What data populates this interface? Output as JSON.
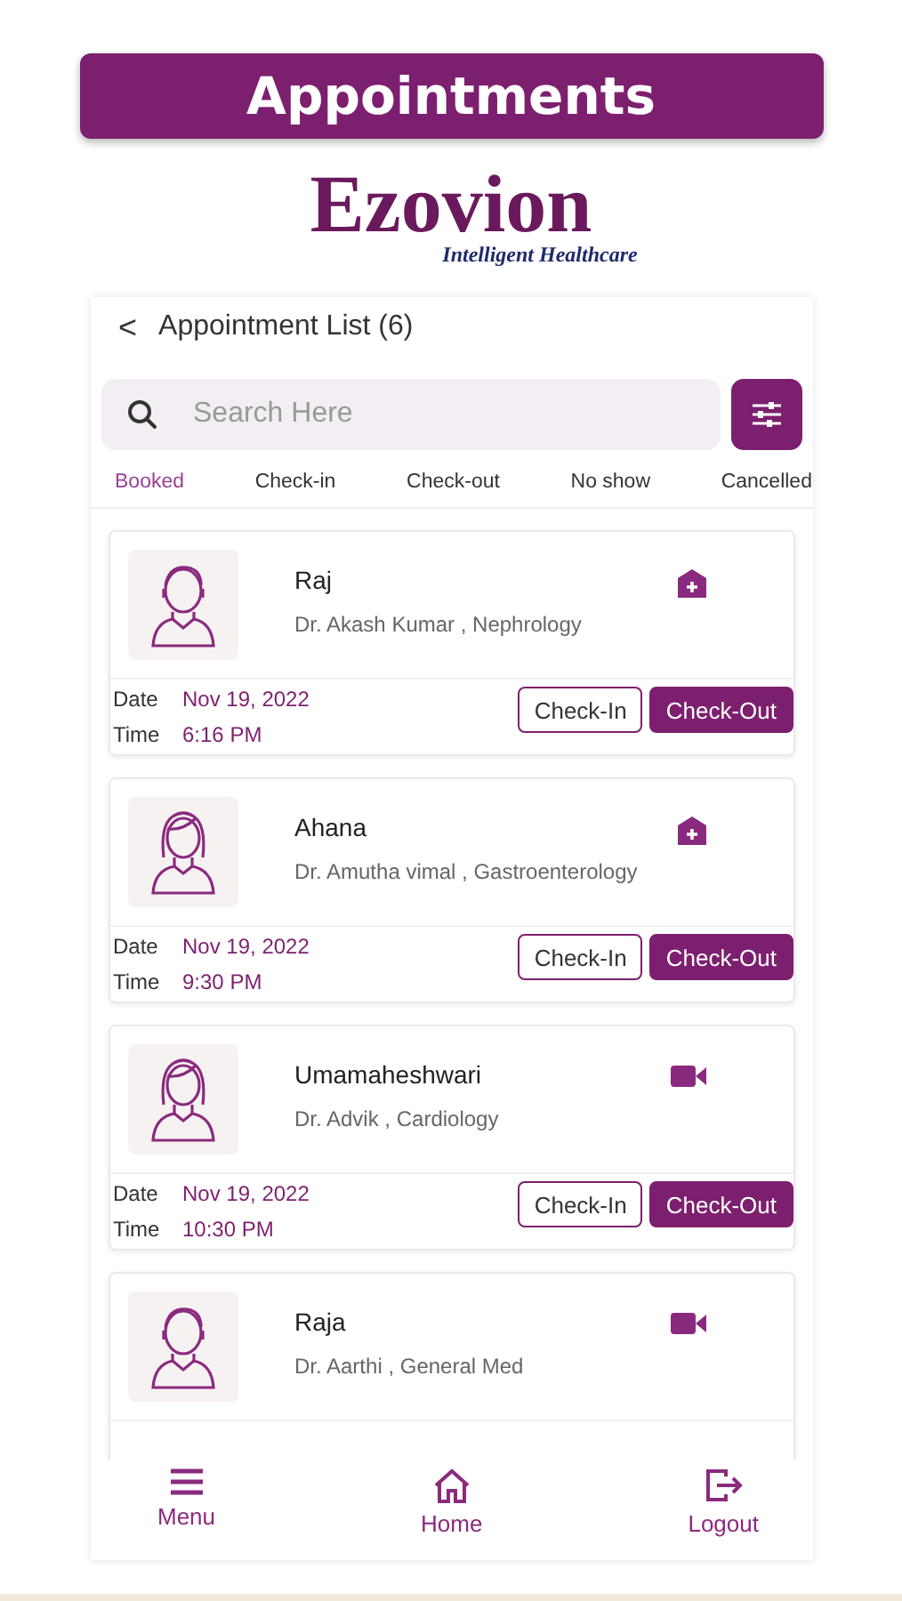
{
  "banner": {
    "title": "Appointments"
  },
  "logo": {
    "name": "Ezovion",
    "tagline": "Intelligent Healthcare"
  },
  "header": {
    "back": "<",
    "title": "Appointment List (6)"
  },
  "search": {
    "placeholder": "Search Here"
  },
  "tabs": [
    {
      "label": "Booked",
      "selected": true
    },
    {
      "label": "Check-in",
      "selected": false
    },
    {
      "label": "Check-out",
      "selected": false
    },
    {
      "label": "No show",
      "selected": false
    },
    {
      "label": "Cancelled",
      "selected": false
    }
  ],
  "appointments": [
    {
      "patient": "Raj",
      "doctor": "Dr. Akash Kumar , Nephrology",
      "avatar": {
        "kind": "male"
      },
      "visit": {
        "kind": "in_person"
      },
      "date_label": "Date",
      "date": "Nov 19, 2022",
      "time_label": "Time",
      "time": "6:16 PM",
      "actions": [
        "Check-In",
        "Check-Out"
      ]
    },
    {
      "patient": "Ahana",
      "doctor": "Dr. Amutha vimal , Gastroenterology",
      "avatar": {
        "kind": "female"
      },
      "visit": {
        "kind": "in_person"
      },
      "date_label": "Date",
      "date": "Nov 19, 2022",
      "time_label": "Time",
      "time": "9:30 PM",
      "actions": [
        "Check-In",
        "Check-Out"
      ]
    },
    {
      "patient": "Umamaheshwari",
      "doctor": "Dr. Advik , Cardiology",
      "avatar": {
        "kind": "female"
      },
      "visit": {
        "kind": "video"
      },
      "date_label": "Date",
      "date": "Nov 19, 2022",
      "time_label": "Time",
      "time": "10:30 PM",
      "actions": [
        "Check-In",
        "Check-Out"
      ]
    },
    {
      "patient": "Raja",
      "doctor": "Dr. Aarthi , General Med",
      "avatar": {
        "kind": "male"
      },
      "visit": {
        "kind": "video"
      }
    }
  ],
  "nav": [
    {
      "kind": "menu",
      "label": "Menu"
    },
    {
      "kind": "home",
      "label": "Home"
    },
    {
      "kind": "logout",
      "label": "Logout"
    }
  ]
}
